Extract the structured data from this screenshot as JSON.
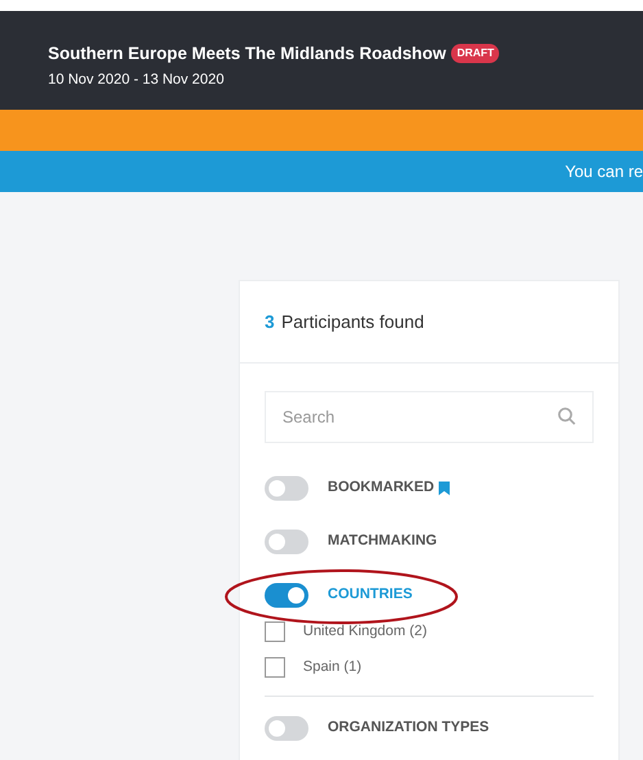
{
  "header": {
    "title": "Southern Europe Meets The Midlands Roadshow",
    "badge": "DRAFT",
    "dates": "10 Nov 2020 - 13 Nov 2020"
  },
  "notice_bar": {
    "text": "You can re"
  },
  "panel": {
    "count": "3",
    "count_label": "Participants found",
    "search": {
      "placeholder": "Search"
    },
    "filters": [
      {
        "label": "BOOKMARKED",
        "on": false,
        "bookmark_icon": true
      },
      {
        "label": "MATCHMAKING",
        "on": false,
        "bookmark_icon": false
      },
      {
        "label": "COUNTRIES",
        "on": true,
        "bookmark_icon": false,
        "options": [
          {
            "label": "United Kingdom (2)",
            "checked": false
          },
          {
            "label": "Spain (1)",
            "checked": false
          }
        ]
      },
      {
        "label": "ORGANIZATION TYPES",
        "on": false,
        "bookmark_icon": false
      }
    ]
  }
}
